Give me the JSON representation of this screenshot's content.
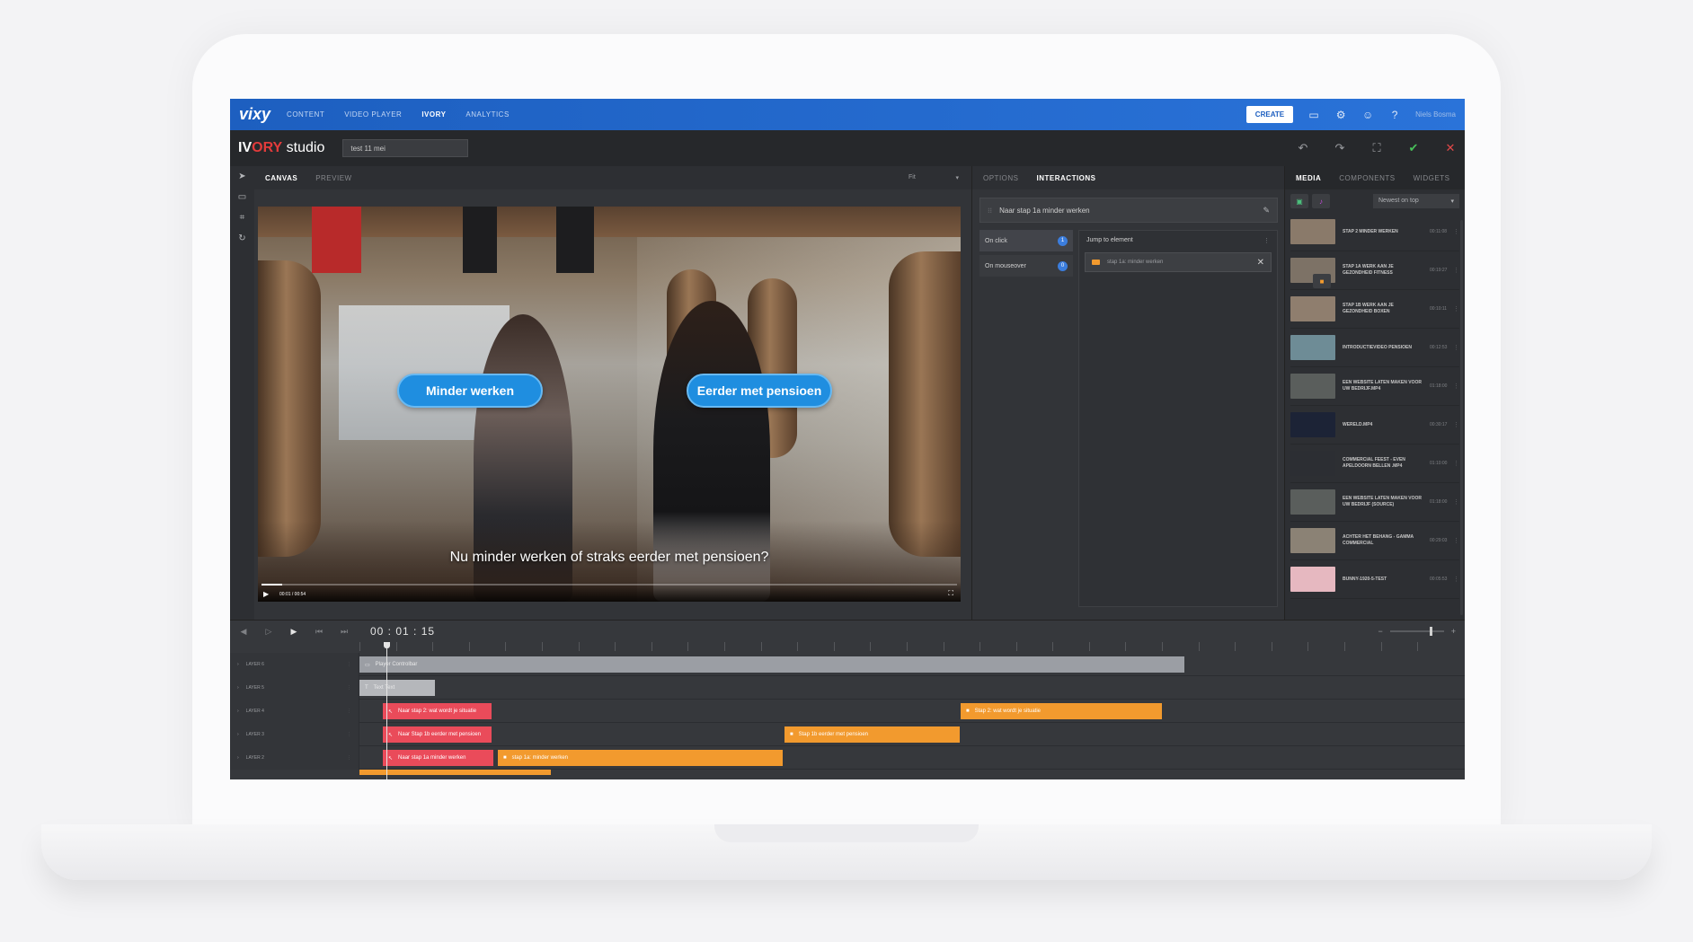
{
  "nav": {
    "logo": "vixy",
    "links": [
      "CONTENT",
      "VIDEO PLAYER",
      "IVORY",
      "ANALYTICS"
    ],
    "create_label": "CREATE",
    "user": "Niels Bosma"
  },
  "studio": {
    "brand_iv": "IV",
    "brand_ory": "ORY",
    "brand_studio": " studio",
    "project_name": "test 11 mei"
  },
  "canvas": {
    "tabs": [
      "CANVAS",
      "PREVIEW"
    ],
    "fit_label": "Fit",
    "button_left": "Minder werken",
    "button_right": "Eerder met pensioen",
    "subtitle": "Nu minder werken of straks eerder met pensioen?",
    "video_time": "00:01 / 00:54",
    "progress": 0.03
  },
  "interactions": {
    "tabs": [
      "OPTIONS",
      "INTERACTIONS"
    ],
    "element_name": "Naar stap 1a minder werken",
    "events": [
      {
        "label": "On click",
        "count": "1"
      },
      {
        "label": "On mouseover",
        "count": "0"
      }
    ],
    "action_title": "Jump to element",
    "target": "stap 1a: minder werken"
  },
  "media": {
    "tabs": [
      "MEDIA",
      "COMPONENTS",
      "WIDGETS"
    ],
    "sort_label": "Newest on top",
    "items": [
      {
        "title": "STAP 2 MINDER WERKEN",
        "duration": "00:11:08",
        "thumb": "#8a7a6a"
      },
      {
        "title": "STAP 1A WERK AAN JE GEZONDHEID FITNESS",
        "duration": "00:19:27",
        "thumb": "#7d7266"
      },
      {
        "title": "STAP 1B WERK AAN JE GEZONDHEID BOXEN",
        "duration": "00:10:11",
        "thumb": "#8f7e6e"
      },
      {
        "title": "INTRODUCTIEVIDEO PENSIOEN",
        "duration": "00:12:53",
        "thumb": "#6e8c96"
      },
      {
        "title": "EEN WEBSITE LATEN MAKEN VOOR UW BEDRIJF.MP4",
        "duration": "01:18:00",
        "thumb": "#5a5e5c"
      },
      {
        "title": "WERELD.MP4",
        "duration": "00:30:17",
        "thumb": "#1c2336"
      },
      {
        "title": "COMMERCIAL FEEST - EVEN APELDOORN BELLEN .MP4",
        "duration": "01:10:00",
        "thumb": "#2c2e33"
      },
      {
        "title": "EEN WEBSITE LATEN MAKEN VOOR UW BEDRIJF (SOURCE)",
        "duration": "01:18:00",
        "thumb": "#5a5e5c"
      },
      {
        "title": "ACHTER HET BEHANG - GAMMA COMMERCIAL",
        "duration": "00:29:03",
        "thumb": "#8b8275"
      },
      {
        "title": "BUNNY-1920-5-TEST",
        "duration": "00:05:53",
        "thumb": "#e6b8c0"
      }
    ]
  },
  "timeline": {
    "timecode": "00 : 01 : 15",
    "layers": [
      {
        "name": "LAYER 6",
        "clips": [
          {
            "label": "Player Controlbar",
            "style": "gray",
            "icon": "▭"
          }
        ]
      },
      {
        "name": "LAYER 5",
        "clips": [
          {
            "label": "Text Text",
            "style": "lightgray",
            "icon": "T"
          }
        ]
      },
      {
        "name": "LAYER 4",
        "clips": [
          {
            "label": "Naar stap 2: wat wordt je situatie",
            "style": "red",
            "icon": "↖"
          },
          {
            "label": "Stap 2: wat wordt je situatie",
            "style": "orange",
            "icon": "■"
          }
        ]
      },
      {
        "name": "LAYER 3",
        "clips": [
          {
            "label": "Naar Stap 1b eerder met pensioen",
            "style": "red",
            "icon": "↖"
          },
          {
            "label": "Stap 1b eerder met pensioen",
            "style": "orange",
            "icon": "■"
          }
        ]
      },
      {
        "name": "LAYER 2",
        "clips": [
          {
            "label": "Naar stap 1a minder werken",
            "style": "red",
            "icon": "↖"
          },
          {
            "label": "stap 1a: minder werken",
            "style": "orange",
            "icon": "■"
          }
        ]
      }
    ]
  }
}
